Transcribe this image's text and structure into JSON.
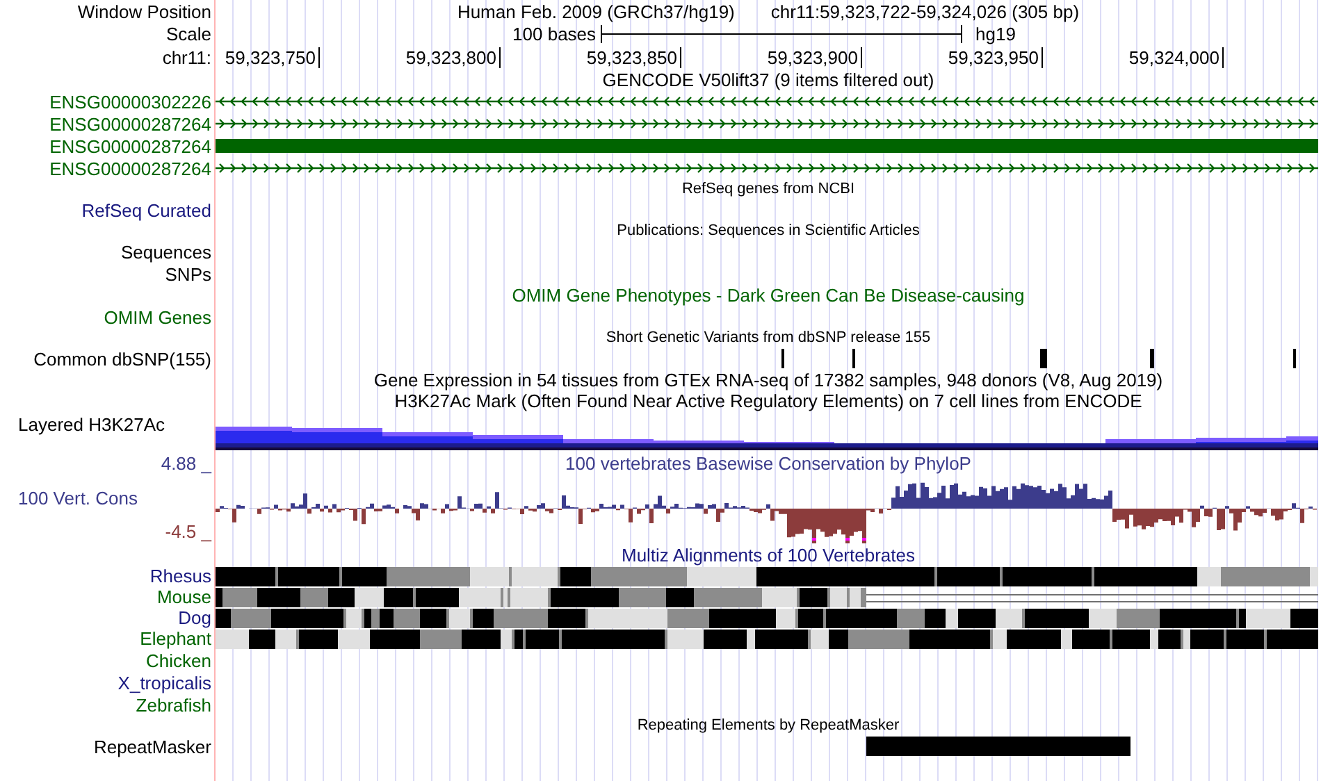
{
  "tracks": [
    {
      "kind": "position",
      "label": "Window Position",
      "assembly": "Human Feb. 2009 (GRCh37/hg19)",
      "range": "chr11:59,323,722-59,324,026 (305 bp)"
    },
    {
      "kind": "scale",
      "label": "Scale",
      "scale": "100 bases",
      "db": "hg19"
    },
    {
      "kind": "ruler",
      "label": "chr11:",
      "ticks": [
        "59,323,750",
        "59,323,800",
        "59,323,850",
        "59,323,900",
        "59,323,950",
        "59,324,000"
      ]
    },
    {
      "kind": "caption",
      "text": "GENCODE V50lift37 (9 items filtered out)",
      "color": "#000000"
    },
    {
      "kind": "reverse",
      "label": "ENSG00000302226",
      "color": "#006400"
    },
    {
      "kind": "forward",
      "label": "ENSG00000287264",
      "color": "#006400"
    },
    {
      "kind": "exon",
      "label": "ENSG00000287264",
      "color": "#006400"
    },
    {
      "kind": "forward",
      "label": "ENSG00000287264",
      "color": "#006400"
    },
    {
      "kind": "note",
      "text": "RefSeq genes from NCBI",
      "color": "#000000"
    },
    {
      "kind": "label",
      "label": "RefSeq Curated",
      "color": "#1a1a80"
    },
    {
      "kind": "note",
      "text": "Publications: Sequences in Scientific Articles",
      "color": "#000000"
    },
    {
      "kind": "label",
      "label": "Sequences",
      "color": "#000000"
    },
    {
      "kind": "label",
      "label": "SNPs",
      "color": "#000000"
    },
    {
      "kind": "caption",
      "text": "OMIM Gene Phenotypes - Dark Green Can Be Disease-causing",
      "color": "#006400"
    },
    {
      "kind": "label",
      "label": "OMIM Genes",
      "color": "#006400"
    },
    {
      "kind": "note",
      "text": "Short Genetic Variants from dbSNP release 155",
      "color": "#000000"
    },
    {
      "kind": "snp",
      "label": "Common dbSNP(155)",
      "color": "#000000"
    },
    {
      "kind": "caption",
      "text": "Gene Expression in 54 tissues from GTEx RNA-seq of 17382 samples, 948 donors (V8, Aug 2019)",
      "color": "#000000"
    },
    {
      "kind": "caption",
      "text": "H3K27Ac Mark (Often Found Near Active Regulatory Elements) on 7 cell lines from ENCODE",
      "color": "#000000"
    },
    {
      "kind": "layered",
      "label": "Layered H3K27Ac",
      "color": "#000000"
    },
    {
      "kind": "wiggle",
      "label": "100 Vert. Cons",
      "max": "4.88 _",
      "min": "-4.5 _",
      "caption": "100 vertebrates Basewise Conservation by PhyloP",
      "color": "#3c3c8c"
    },
    {
      "kind": "caption",
      "text": "Multiz Alignments of 100 Vertebrates",
      "color": "#1a1a80"
    },
    {
      "kind": "align",
      "label": "Rhesus",
      "color": "#1a1a80"
    },
    {
      "kind": "partial",
      "label": "Mouse",
      "color": "#006400"
    },
    {
      "kind": "align",
      "label": "Dog",
      "color": "#1a1a80"
    },
    {
      "kind": "align",
      "label": "Elephant",
      "color": "#006400"
    },
    {
      "kind": "label",
      "label": "Chicken",
      "color": "#006400"
    },
    {
      "kind": "label",
      "label": "X_tropicalis",
      "color": "#1a1a80"
    },
    {
      "kind": "label",
      "label": "Zebrafish",
      "color": "#006400"
    },
    {
      "kind": "note",
      "text": "Repeating Elements by RepeatMasker",
      "color": "#000000"
    },
    {
      "kind": "repeat",
      "label": "RepeatMasker",
      "color": "#000000"
    }
  ]
}
